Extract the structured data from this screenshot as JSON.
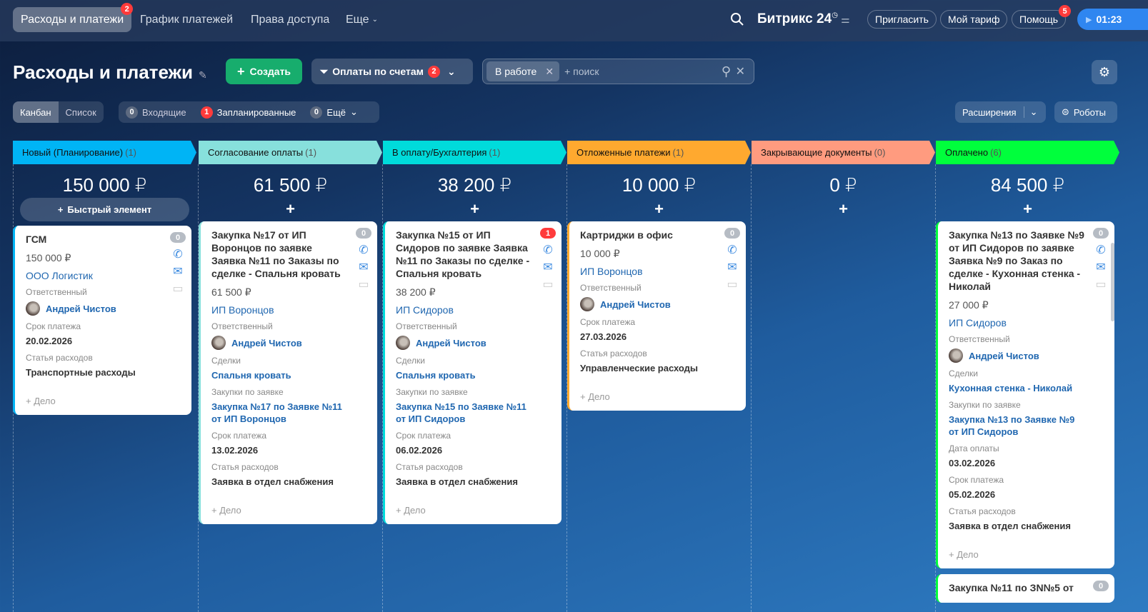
{
  "topnav": {
    "items": [
      {
        "label": "Расходы и платежи",
        "badge": "2"
      },
      {
        "label": "График платежей"
      },
      {
        "label": "Права доступа"
      },
      {
        "label": "Еще"
      }
    ],
    "brand": "Битрикс",
    "brand_num": "24",
    "invite": "Пригласить",
    "tariff": "Мой тариф",
    "help": "Помощь",
    "help_badge": "5",
    "timer": "01:23"
  },
  "header": {
    "title": "Расходы и платежи",
    "create": "Создать",
    "filter_label": "Оплаты по счетам",
    "filter_badge": "2",
    "search_tag": "В работе",
    "search_placeholder": "+ поиск"
  },
  "toolbar": {
    "views": [
      "Канбан",
      "Список"
    ],
    "counters": [
      {
        "n": "0",
        "label": "Входящие"
      },
      {
        "n": "1",
        "label": "Запланированные"
      },
      {
        "n": "0",
        "label": "Ещё"
      }
    ],
    "extensions": "Расширения",
    "robots": "Роботы"
  },
  "quick_add": "Быстрый элемент",
  "columns": [
    {
      "name": "Новый (Планирование)",
      "count": "(1)",
      "sum": "150 000 ₽",
      "color": "#00b4f5",
      "cards": [
        {
          "title": "ГСМ",
          "amount": "150 000 ₽",
          "company": "ООО Логистик",
          "counter": "0",
          "resp_label": "Ответственный",
          "person": "Андрей Чистов",
          "fields": [
            {
              "label": "Срок платежа",
              "value": "20.02.2026"
            },
            {
              "label": "Статья расходов",
              "value": "Транспортные расходы"
            }
          ],
          "deal": "+ Дело"
        }
      ]
    },
    {
      "name": "Согласование оплаты",
      "count": "(1)",
      "sum": "61 500 ₽",
      "color": "#87e0dc",
      "cards": [
        {
          "title": "Закупка №17 от ИП Воронцов по заявке Заявка №11 по Заказы по сделке - Спальня кровать",
          "amount": "61 500 ₽",
          "company": "ИП Воронцов",
          "counter": "0",
          "resp_label": "Ответственный",
          "person": "Андрей Чистов",
          "fields": [
            {
              "label": "Сделки",
              "value": "Спальня кровать",
              "link": true
            },
            {
              "label": "Закупки по заявке",
              "value": "Закупка №17 по Заявке №11 от ИП Воронцов",
              "link": true
            },
            {
              "label": "Срок платежа",
              "value": "13.02.2026"
            },
            {
              "label": "Статья расходов",
              "value": "Заявка в отдел снабжения"
            }
          ],
          "deal": "+ Дело"
        }
      ]
    },
    {
      "name": "В оплату/Бухгалтерия",
      "count": "(1)",
      "sum": "38 200 ₽",
      "color": "#00dbdb",
      "cards": [
        {
          "title": "Закупка №15 от ИП Сидоров по заявке Заявка №11 по Заказы по сделке - Спальня кровать",
          "amount": "38 200 ₽",
          "company": "ИП Сидоров",
          "counter": "1",
          "counter_red": true,
          "resp_label": "Ответственный",
          "person": "Андрей Чистов",
          "fields": [
            {
              "label": "Сделки",
              "value": "Спальня кровать",
              "link": true
            },
            {
              "label": "Закупки по заявке",
              "value": "Закупка №15 по Заявке №11 от ИП Сидоров",
              "link": true
            },
            {
              "label": "Срок платежа",
              "value": "06.02.2026"
            },
            {
              "label": "Статья расходов",
              "value": "Заявка в отдел снабжения"
            }
          ],
          "deal": "+ Дело"
        }
      ]
    },
    {
      "name": "Отложенные платежи",
      "count": "(1)",
      "sum": "10 000 ₽",
      "color": "#ffa92f",
      "cards": [
        {
          "title": "Картриджи в офис",
          "amount": "10 000 ₽",
          "company": "ИП Воронцов",
          "counter": "0",
          "resp_label": "Ответственный",
          "person": "Андрей Чистов",
          "fields": [
            {
              "label": "Срок платежа",
              "value": "27.03.2026"
            },
            {
              "label": "Статья расходов",
              "value": "Управленческие расходы"
            }
          ],
          "deal": "+ Дело"
        }
      ]
    },
    {
      "name": "Закрывающие документы",
      "count": "(0)",
      "sum": "0 ₽",
      "color": "#ff9b7f",
      "cards": []
    },
    {
      "name": "Оплачено",
      "count": "(6)",
      "sum": "84 500 ₽",
      "color": "#00ff3c",
      "cards": [
        {
          "title": "Закупка №13 по Заявке №9 от ИП Сидоров по заявке Заявка №9 по Заказ по сделке - Кухонная стенка - Николай",
          "amount": "27 000 ₽",
          "company": "ИП Сидоров",
          "counter": "0",
          "resp_label": "Ответственный",
          "person": "Андрей Чистов",
          "fields": [
            {
              "label": "Сделки",
              "value": "Кухонная стенка - Николай",
              "link": true
            },
            {
              "label": "Закупки по заявке",
              "value": "Закупка №13 по Заявке №9 от ИП Сидоров",
              "link": true
            },
            {
              "label": "Дата оплаты",
              "value": "03.02.2026"
            },
            {
              "label": "Срок платежа",
              "value": "05.02.2026"
            },
            {
              "label": "Статья расходов",
              "value": "Заявка в отдел снабжения"
            }
          ],
          "deal": "+ Дело"
        },
        {
          "title": "Закупка №11 по ЗN№5 от",
          "counter": "0",
          "partial": true
        }
      ]
    }
  ]
}
